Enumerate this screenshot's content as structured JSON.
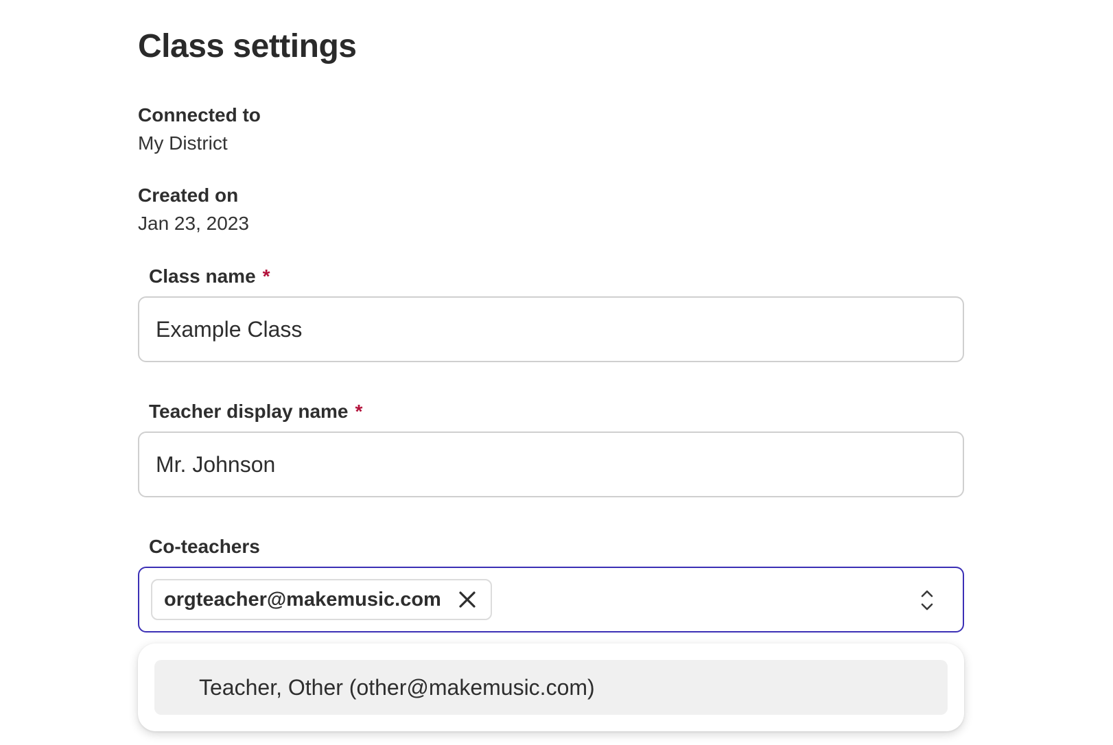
{
  "page": {
    "title": "Class settings"
  },
  "meta": {
    "connected_label": "Connected to",
    "connected_value": "My District",
    "created_label": "Created on",
    "created_value": "Jan 23, 2023"
  },
  "form": {
    "class_name": {
      "label": "Class name",
      "required_mark": "*",
      "value": "Example Class"
    },
    "teacher_name": {
      "label": "Teacher display name",
      "required_mark": "*",
      "value": "Mr. Johnson"
    },
    "co_teachers": {
      "label": "Co-teachers",
      "selected": [
        "orgteacher@makemusic.com"
      ],
      "options": [
        "Teacher, Other (other@makemusic.com)"
      ]
    }
  },
  "colors": {
    "accent": "#3b2fb5",
    "required": "#b3123b",
    "highlight": "#f0f0f0"
  },
  "icons": {
    "chip_remove": "close-icon",
    "combo_toggle": "chevron-up-down-icon"
  }
}
